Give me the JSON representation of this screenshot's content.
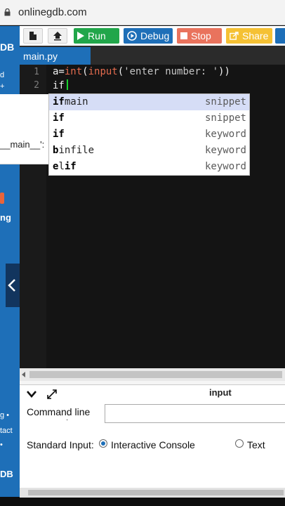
{
  "browser": {
    "url": "onlinegdb.com"
  },
  "sidebar": {
    "brand_fragment": "DB",
    "line1": "d",
    "line2": "+",
    "item_fragment": "ng",
    "footer1": "g •",
    "footer2": "tact",
    "footer3": "•",
    "footer_brand": "DB"
  },
  "left_popup": {
    "text": "__main__':"
  },
  "toolbar": {
    "run": "Run",
    "debug": "Debug",
    "stop": "Stop",
    "share": "Share"
  },
  "editor": {
    "tab": "main.py",
    "lines": [
      {
        "num": "1",
        "var": "a=",
        "fn1": "int",
        "p1": "(",
        "fn2": "input",
        "p2": "(",
        "str": "'enter number: '",
        "p3": "))"
      },
      {
        "num": "2",
        "text": "if"
      }
    ]
  },
  "autocomplete": [
    {
      "match": "if",
      "rest": "main",
      "meta": "snippet"
    },
    {
      "match": "if",
      "rest": "",
      "meta": "snippet"
    },
    {
      "match": "if",
      "rest": "",
      "meta": "keyword"
    },
    {
      "match": "bi",
      "rest": "nfile",
      "meta": "keyword",
      "split": true
    },
    {
      "match": "el",
      "rest": "if",
      "meta": "keyword",
      "split2": true
    }
  ],
  "panel": {
    "input_tab": "input",
    "command_line_label": "Command line",
    "command_line_dot": "·",
    "stdin_label": "Standard Input:",
    "option1": "Interactive Console",
    "option2": "Text"
  },
  "colors": {
    "accent": "#1e6fb8",
    "run": "#21a64a",
    "stop": "#e9735d",
    "share": "#f5c134"
  }
}
